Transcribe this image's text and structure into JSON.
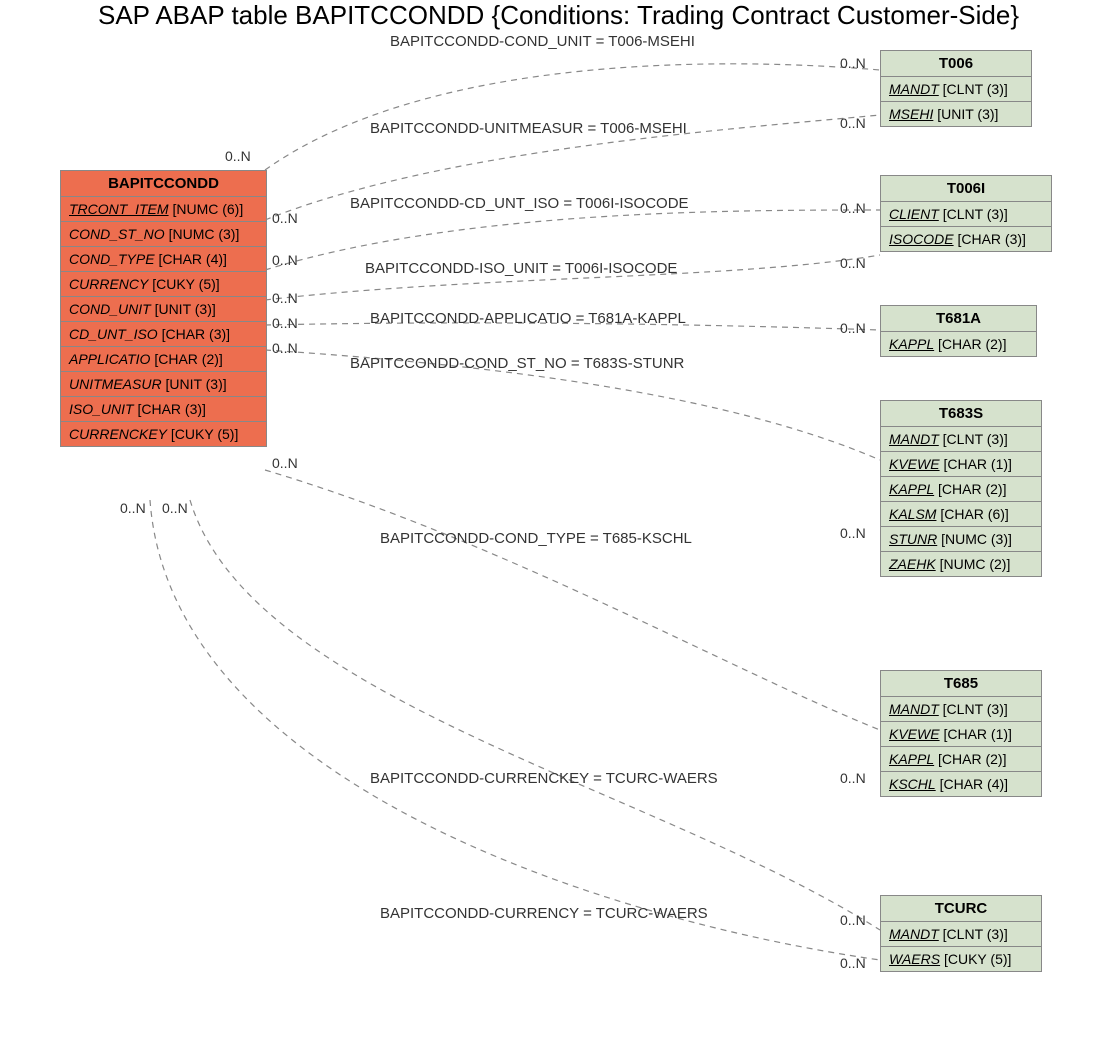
{
  "title": "SAP ABAP table BAPITCCONDD {Conditions: Trading Contract Customer-Side}",
  "main_table": {
    "name": "BAPITCCONDD",
    "fields": [
      {
        "name": "TRCONT_ITEM",
        "type": "[NUMC (6)]",
        "key": true
      },
      {
        "name": "COND_ST_NO",
        "type": "[NUMC (3)]",
        "key": false
      },
      {
        "name": "COND_TYPE",
        "type": "[CHAR (4)]",
        "key": false
      },
      {
        "name": "CURRENCY",
        "type": "[CUKY (5)]",
        "key": false
      },
      {
        "name": "COND_UNIT",
        "type": "[UNIT (3)]",
        "key": false
      },
      {
        "name": "CD_UNT_ISO",
        "type": "[CHAR (3)]",
        "key": false
      },
      {
        "name": "APPLICATIO",
        "type": "[CHAR (2)]",
        "key": false
      },
      {
        "name": "UNITMEASUR",
        "type": "[UNIT (3)]",
        "key": false
      },
      {
        "name": "ISO_UNIT",
        "type": "[CHAR (3)]",
        "key": false
      },
      {
        "name": "CURRENCKEY",
        "type": "[CUKY (5)]",
        "key": false
      }
    ]
  },
  "ref_tables": [
    {
      "name": "T006",
      "fields": [
        {
          "name": "MANDT",
          "type": "[CLNT (3)]",
          "key": true
        },
        {
          "name": "MSEHI",
          "type": "[UNIT (3)]",
          "key": true
        }
      ]
    },
    {
      "name": "T006I",
      "fields": [
        {
          "name": "CLIENT",
          "type": "[CLNT (3)]",
          "key": true
        },
        {
          "name": "ISOCODE",
          "type": "[CHAR (3)]",
          "key": true
        }
      ]
    },
    {
      "name": "T681A",
      "fields": [
        {
          "name": "KAPPL",
          "type": "[CHAR (2)]",
          "key": true
        }
      ]
    },
    {
      "name": "T683S",
      "fields": [
        {
          "name": "MANDT",
          "type": "[CLNT (3)]",
          "key": true
        },
        {
          "name": "KVEWE",
          "type": "[CHAR (1)]",
          "key": true
        },
        {
          "name": "KAPPL",
          "type": "[CHAR (2)]",
          "key": true
        },
        {
          "name": "KALSM",
          "type": "[CHAR (6)]",
          "key": true
        },
        {
          "name": "STUNR",
          "type": "[NUMC (3)]",
          "key": true
        },
        {
          "name": "ZAEHK",
          "type": "[NUMC (2)]",
          "key": true
        }
      ]
    },
    {
      "name": "T685",
      "fields": [
        {
          "name": "MANDT",
          "type": "[CLNT (3)]",
          "key": true
        },
        {
          "name": "KVEWE",
          "type": "[CHAR (1)]",
          "key": true
        },
        {
          "name": "KAPPL",
          "type": "[CHAR (2)]",
          "key": true
        },
        {
          "name": "KSCHL",
          "type": "[CHAR (4)]",
          "key": true
        }
      ]
    },
    {
      "name": "TCURC",
      "fields": [
        {
          "name": "MANDT",
          "type": "[CLNT (3)]",
          "key": true
        },
        {
          "name": "WAERS",
          "type": "[CUKY (5)]",
          "key": true
        }
      ]
    }
  ],
  "relations": [
    {
      "label": "BAPITCCONDD-COND_UNIT = T006-MSEHI",
      "left_card": "0..N",
      "right_card": "0..N"
    },
    {
      "label": "BAPITCCONDD-UNITMEASUR = T006-MSEHI",
      "left_card": "0..N",
      "right_card": "0..N"
    },
    {
      "label": "BAPITCCONDD-CD_UNT_ISO = T006I-ISOCODE",
      "left_card": "0..N",
      "right_card": "0..N"
    },
    {
      "label": "BAPITCCONDD-ISO_UNIT = T006I-ISOCODE",
      "left_card": "0..N",
      "right_card": "0..N"
    },
    {
      "label": "BAPITCCONDD-APPLICATIO = T681A-KAPPL",
      "left_card": "0..N",
      "right_card": "0..N"
    },
    {
      "label": "BAPITCCONDD-COND_ST_NO = T683S-STUNR",
      "left_card": "0..N",
      "right_card": "0..N"
    },
    {
      "label": "BAPITCCONDD-COND_TYPE = T685-KSCHL",
      "left_card": "0..N",
      "right_card": "0..N"
    },
    {
      "label": "BAPITCCONDD-CURRENCKEY = TCURC-WAERS",
      "left_card": "0..N",
      "right_card": "0..N"
    },
    {
      "label": "BAPITCCONDD-CURRENCY = TCURC-WAERS",
      "left_card": "0..N",
      "right_card": "0..N"
    }
  ]
}
